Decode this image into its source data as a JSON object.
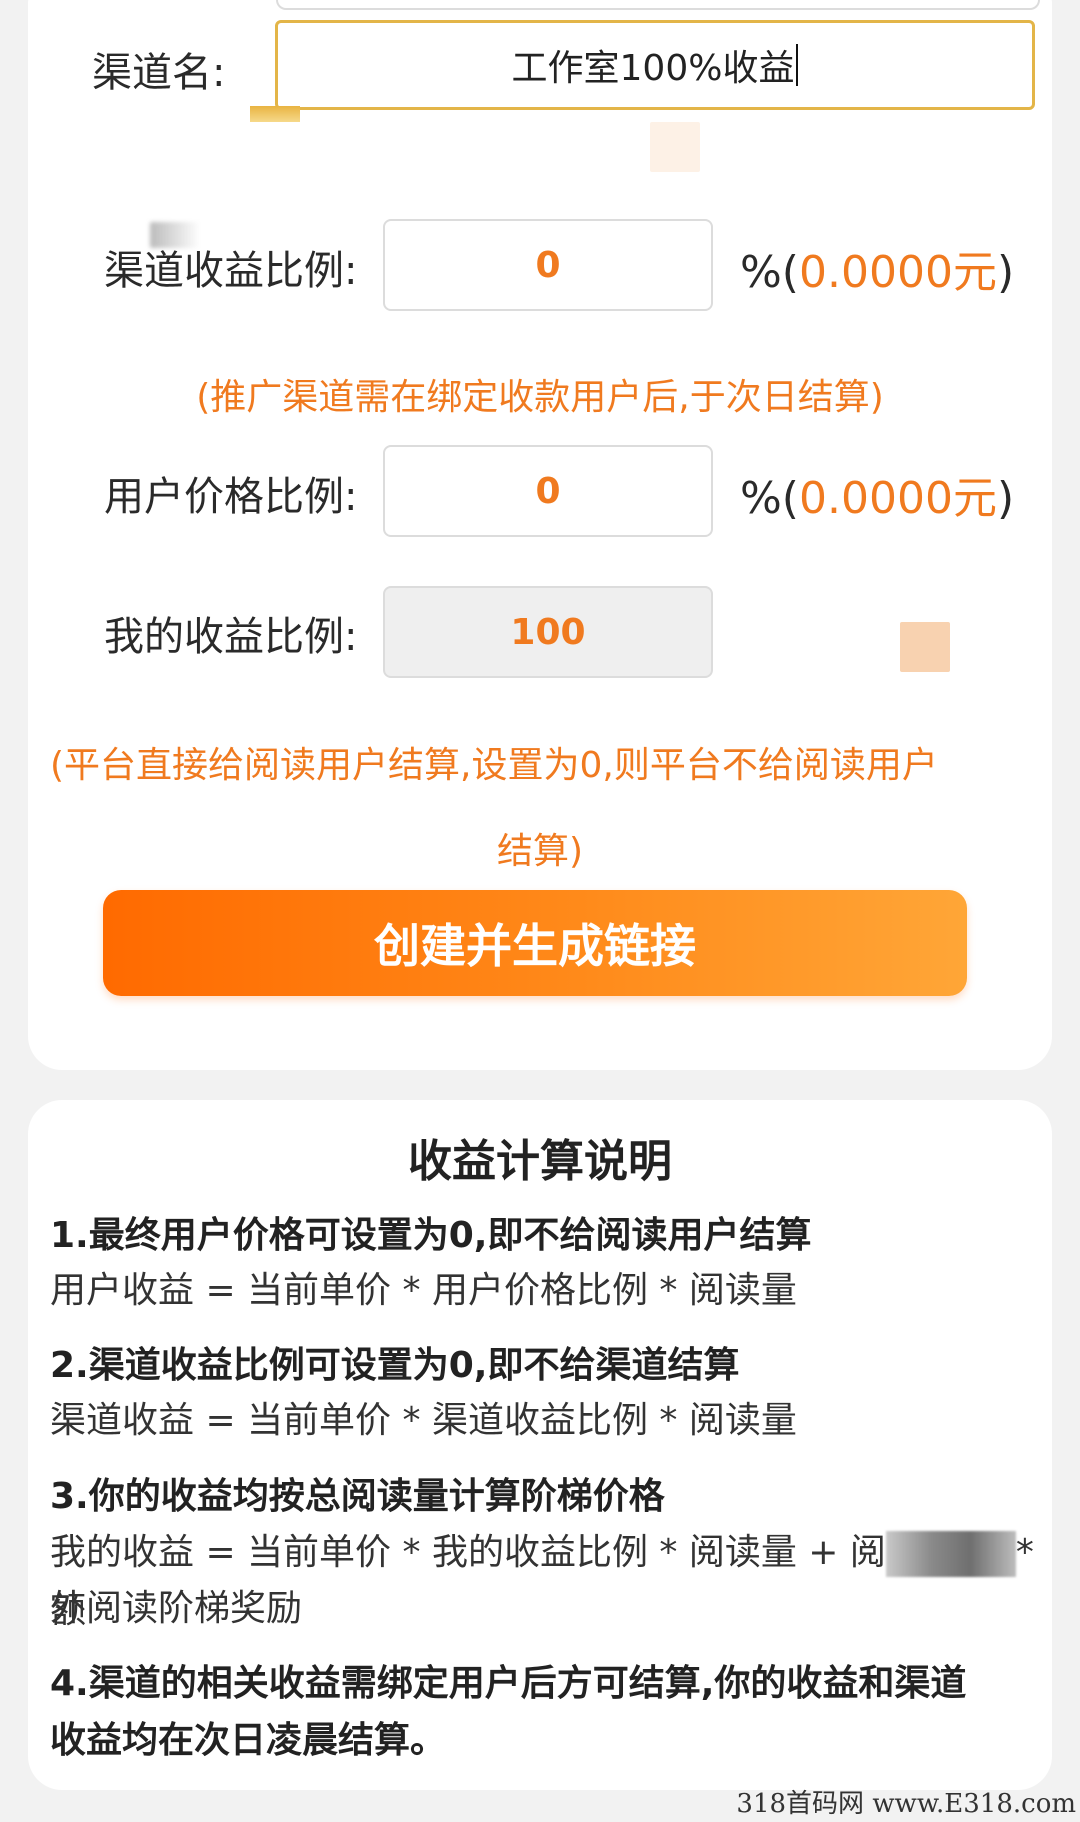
{
  "form": {
    "channel_name_label": "渠道名:",
    "channel_name_value": "工作室100%收益",
    "channel_ratio_label": "渠道收益比例:",
    "channel_ratio_value": "0",
    "channel_ratio_pct": "%(",
    "channel_ratio_amount": "0.0000元",
    "channel_ratio_close": ")",
    "channel_note": "(推广渠道需在绑定收款用户后,于次日结算)",
    "user_ratio_label": "用户价格比例:",
    "user_ratio_value": "0",
    "user_ratio_pct": "%(",
    "user_ratio_amount": "0.0000元",
    "user_ratio_close": ")",
    "my_ratio_label": "我的收益比例:",
    "my_ratio_value": "100",
    "platform_note_line1": "(平台直接给阅读用户结算,设置为0,则平台不给阅读用户",
    "platform_note_line2": "结算)",
    "create_button": "创建并生成链接"
  },
  "explanation": {
    "title": "收益计算说明",
    "rules": [
      {
        "title": "1.最终用户价格可设置为0,即不给阅读用户结算",
        "text": "用户收益 = 当前单价 * 用户价格比例 * 阅读量"
      },
      {
        "title": "2.渠道收益比例可设置为0,即不给渠道结算",
        "text": "渠道收益 = 当前单价 * 渠道收益比例 * 阅读量"
      },
      {
        "title": "3.你的收益均按总阅读量计算阶梯价格",
        "text_before": "我的收益 = 当前单价 * 我的收益比例 * 阅读量 + 阅",
        "text_after": "*额",
        "text_line2": "外阅读阶梯奖励"
      },
      {
        "title_line1": "4.渠道的相关收益需绑定用户后方可结算,你的收益和渠道",
        "title_line2": "收益均在次日凌晨结算。"
      }
    ]
  },
  "watermark": "318首码网 www.E318.com",
  "colors": {
    "accent_orange": "#f07a1f",
    "button_gradient_start": "#ff6a00",
    "button_gradient_end": "#ffa637",
    "focused_border": "#e3b548",
    "background": "#f2f2f2",
    "card": "#ffffff"
  }
}
